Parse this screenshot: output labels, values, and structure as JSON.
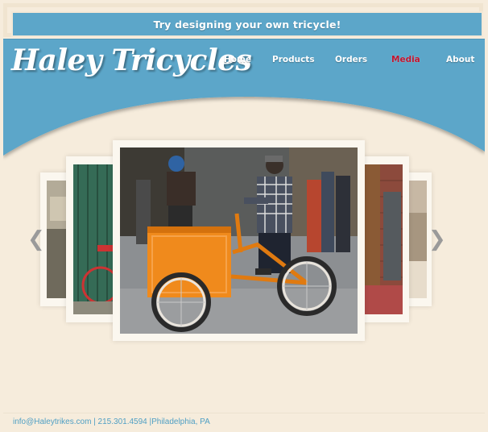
{
  "banner": {
    "text": "Try designing your own tricycle!"
  },
  "site": {
    "logo": "Haley Tricycles"
  },
  "nav": {
    "items": [
      {
        "label": "Home"
      },
      {
        "label": "Products"
      },
      {
        "label": "Orders"
      },
      {
        "label": "Media"
      },
      {
        "label": "About"
      }
    ],
    "active_index": 3
  },
  "carousel": {
    "prev_icon": "chevron-left-icon",
    "next_icon": "chevron-right-icon",
    "prev_glyph": "❮",
    "next_glyph": "❯"
  },
  "footer": {
    "text": "info@Haleytrikes.com | 215.301.4594 |Philadelphia, PA"
  },
  "colors": {
    "header_blue": "#5ca6c9",
    "page_cream": "#f6ecdc",
    "active_nav_red": "#c0152f",
    "footer_link": "#4f9fc4"
  }
}
